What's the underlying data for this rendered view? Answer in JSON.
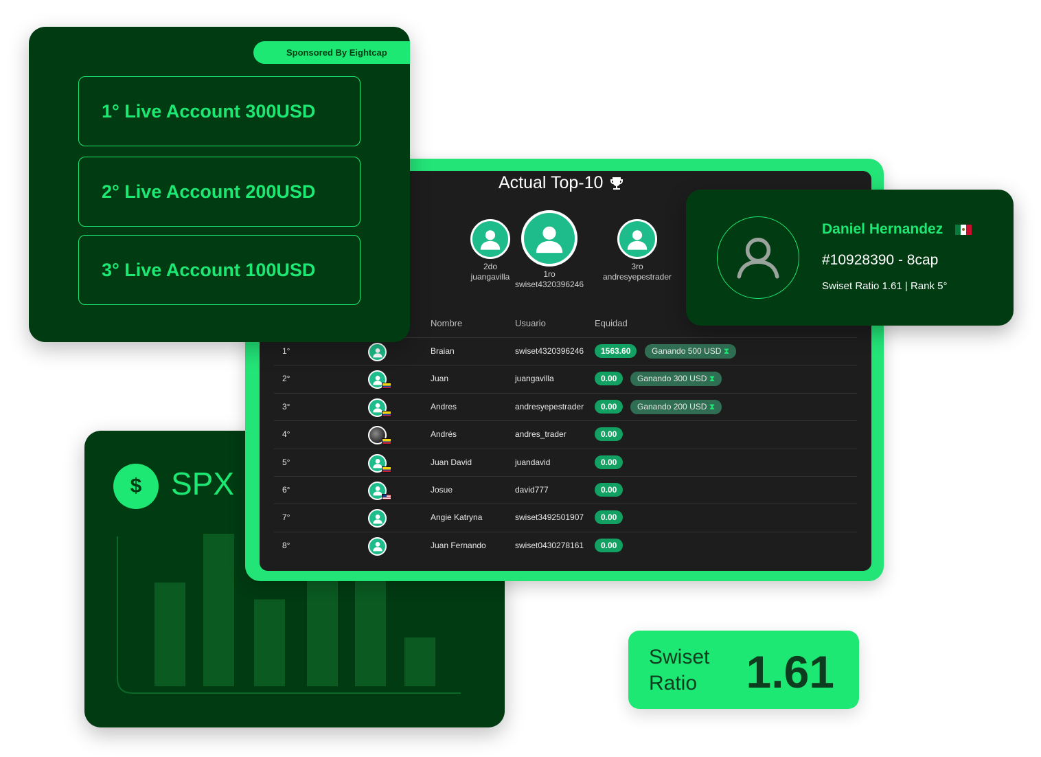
{
  "prizes": {
    "sponsor": "Sponsored By Eightcap",
    "items": [
      "1° Live Account 300USD",
      "2° Live Account 200USD",
      "3° Live Account 100USD"
    ]
  },
  "leaderboard": {
    "title": "Actual Top-10",
    "podium": [
      {
        "place": "2do",
        "user": "juangavilla"
      },
      {
        "place": "1ro",
        "user": "swiset4320396246"
      },
      {
        "place": "3ro",
        "user": "andresyepestrader"
      }
    ],
    "columns": {
      "name": "Nombre",
      "user": "Usuario",
      "equity": "Equidad"
    },
    "rows": [
      {
        "rank": "1°",
        "name": "Braian",
        "user": "swiset4320396246",
        "equity": "1563.60",
        "prize": "Ganando 500 USD",
        "flag": ""
      },
      {
        "rank": "2°",
        "name": "Juan",
        "user": "juangavilla",
        "equity": "0.00",
        "prize": "Ganando 300 USD",
        "flag": "co"
      },
      {
        "rank": "3°",
        "name": "Andres",
        "user": "andresyepestrader",
        "equity": "0.00",
        "prize": "Ganando 200 USD",
        "flag": "co"
      },
      {
        "rank": "4°",
        "name": "Andrés",
        "user": "andres_trader",
        "equity": "0.00",
        "prize": "",
        "flag": "co"
      },
      {
        "rank": "5°",
        "name": "Juan David",
        "user": "juandavid",
        "equity": "0.00",
        "prize": "",
        "flag": "co"
      },
      {
        "rank": "6°",
        "name": "Josue",
        "user": "david777",
        "equity": "0.00",
        "prize": "",
        "flag": "us"
      },
      {
        "rank": "7°",
        "name": "Angie Katryna",
        "user": "swiset3492501907",
        "equity": "0.00",
        "prize": "",
        "flag": ""
      },
      {
        "rank": "8°",
        "name": "Juan Fernando",
        "user": "swiset0430278161",
        "equity": "0.00",
        "prize": "",
        "flag": ""
      }
    ]
  },
  "profile": {
    "name": "Daniel Hernandez",
    "id": "#10928390 - 8cap",
    "ratio_line": "Swiset Ratio 1.61 | Rank 5°",
    "flag": "mexico-flag-icon"
  },
  "spx": {
    "symbol": "SPX",
    "coin_glyph": "$"
  },
  "chart_data": {
    "type": "bar",
    "values": [
      0.68,
      1.0,
      0.57,
      0.8,
      0.72,
      0.32
    ],
    "color": "#0a5a22"
  },
  "ratio_badge": {
    "label": "Swiset Ratio",
    "value": "1.61"
  },
  "colors": {
    "accent": "#1ee874",
    "card_bg": "#003b12",
    "board_bg": "#1d1d1d",
    "equity_chip": "#12a063"
  }
}
